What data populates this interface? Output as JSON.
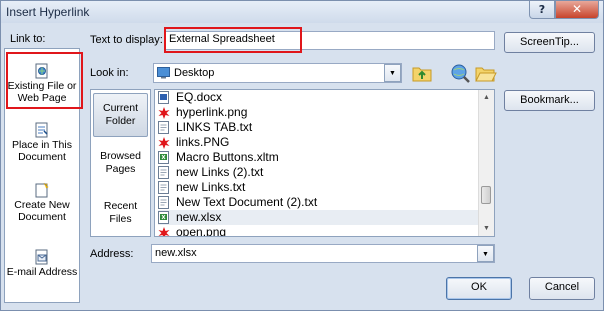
{
  "window": {
    "title": "Insert Hyperlink",
    "help_glyph": "?",
    "close_glyph": "✕"
  },
  "link_to": {
    "label": "Link to:",
    "items": [
      {
        "label": "Existing File or Web Page",
        "icon": "existing-file-icon",
        "selected": true
      },
      {
        "label": "Place in This Document",
        "icon": "place-in-document-icon"
      },
      {
        "label": "Create New Document",
        "icon": "new-document-icon"
      },
      {
        "label": "E-mail Address",
        "icon": "email-icon"
      }
    ]
  },
  "text_to_display": {
    "label": "Text to display:",
    "value": "External Spreadsheet"
  },
  "screentip_button": "ScreenTip...",
  "look_in": {
    "label": "Look in:",
    "value": "Desktop"
  },
  "places": [
    {
      "label": "Current Folder",
      "selected": true
    },
    {
      "label": "Browsed Pages"
    },
    {
      "label": "Recent Files"
    }
  ],
  "files": [
    {
      "name": "EQ.docx",
      "icon": "word-icon"
    },
    {
      "name": "hyperlink.png",
      "icon": "image-icon"
    },
    {
      "name": "LINKS TAB.txt",
      "icon": "text-file-icon"
    },
    {
      "name": "links.PNG",
      "icon": "image-icon"
    },
    {
      "name": "Macro Buttons.xltm",
      "icon": "excel-template-icon"
    },
    {
      "name": "new Links (2).txt",
      "icon": "text-file-icon"
    },
    {
      "name": "new Links.txt",
      "icon": "text-file-icon"
    },
    {
      "name": "New Text Document (2).txt",
      "icon": "text-file-icon"
    },
    {
      "name": "new.xlsx",
      "icon": "excel-icon",
      "selected": true
    },
    {
      "name": "open.png",
      "icon": "image-icon"
    }
  ],
  "bookmark_button": "Bookmark...",
  "address": {
    "label": "Address:",
    "value": "new.xlsx"
  },
  "ok_button": "OK",
  "cancel_button": "Cancel",
  "colors": {
    "highlight": "#e0161b",
    "dialog_bg": "#d7e1ee"
  }
}
